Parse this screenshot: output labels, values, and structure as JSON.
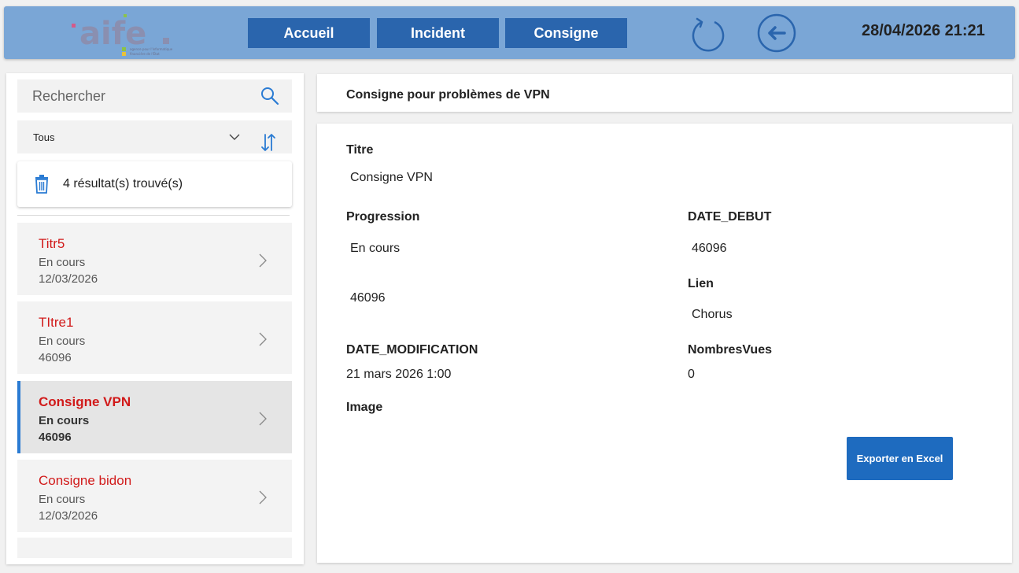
{
  "header": {
    "logo_text": "aife.",
    "logo_subtitle": "agence pour l'informatique financière de l'État",
    "nav": {
      "accueil": "Accueil",
      "incident": "Incident",
      "consigne": "Consigne"
    },
    "datetime": "28/04/2026 21:21",
    "color": "#7aa6d6",
    "button_color": "#2a65ad"
  },
  "sidebar": {
    "search_placeholder": "Rechercher",
    "filter_value": "Tous",
    "results_text": "4 résultat(s) trouvé(s)",
    "items": [
      {
        "title": "Titr5",
        "status": "En cours",
        "date": "12/03/2026"
      },
      {
        "title": "TItre1",
        "status": "En cours",
        "date": "46096"
      },
      {
        "title": "Consigne VPN",
        "status": "En cours",
        "date": "46096"
      },
      {
        "title": "Consigne bidon",
        "status": "En cours",
        "date": "12/03/2026"
      }
    ],
    "title_color": "#d11a1a",
    "accent_color": "#2a7bd3"
  },
  "detail": {
    "header_title": "Consigne pour problèmes de VPN",
    "titre_label": "Titre",
    "titre_value": "Consigne VPN",
    "progression_label": "Progression",
    "progression_value": "En cours",
    "progression_value2": "46096",
    "date_debut_label": "DATE_DEBUT",
    "date_debut_value": "46096",
    "lien_label": "Lien",
    "lien_value": "Chorus",
    "date_modification_label": "DATE_MODIFICATION",
    "date_modification_value": "21 mars 2026 1:00",
    "nombres_vues_label": "NombresVues",
    "nombres_vues_value": "0",
    "image_label": "Image",
    "export_button": "Exporter en Excel"
  }
}
